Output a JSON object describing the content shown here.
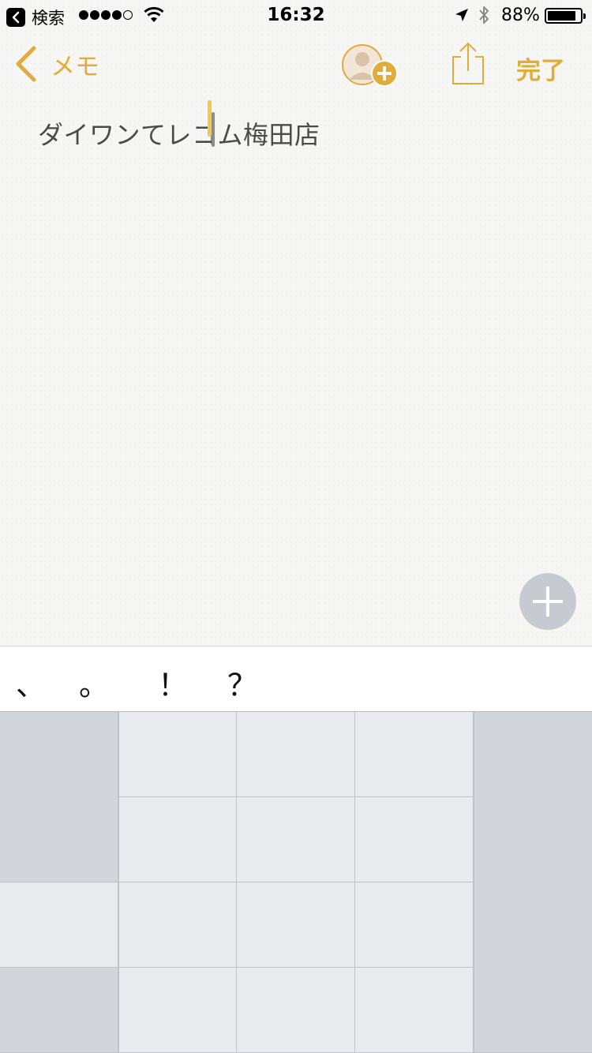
{
  "status_bar": {
    "back_app_label": "検索",
    "time": "16:32",
    "battery_percent": "88%",
    "battery_level": 0.88,
    "signal_bars_filled": 4,
    "signal_bars_total": 5
  },
  "nav": {
    "back_label": "メモ",
    "done_label": "完了"
  },
  "note": {
    "text": "ダイワンてレコム梅田店"
  },
  "candidates": [
    "、",
    "。",
    "！",
    "？"
  ],
  "colors": {
    "accent": "#e0ac3a",
    "paper": "#f6f6f4",
    "keyboard_bg": "#d2d5da",
    "key_bg": "#e9eaed",
    "fab_bg": "#c7cad0"
  },
  "icons": {
    "back": "chevron-left-icon",
    "add_person": "add-person-icon",
    "share": "share-icon",
    "add": "plus-icon",
    "location": "location-arrow-icon",
    "bluetooth": "bluetooth-icon",
    "wifi": "wifi-icon"
  }
}
